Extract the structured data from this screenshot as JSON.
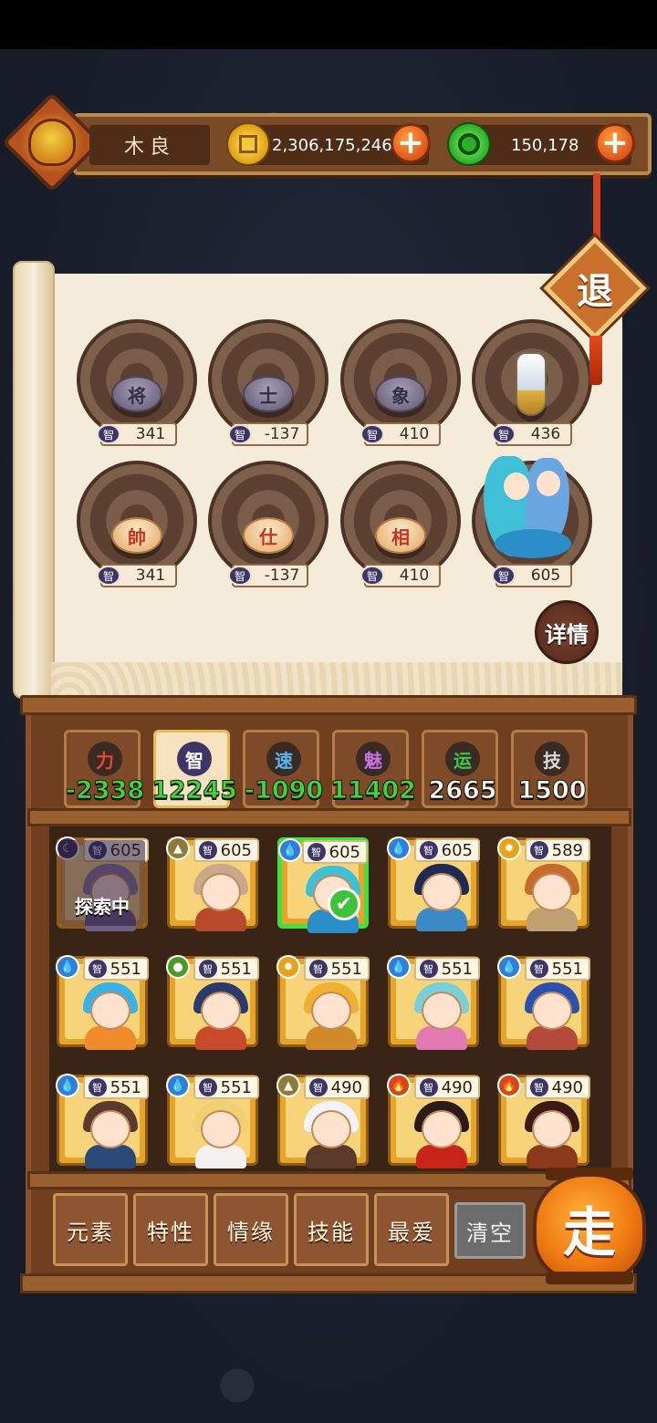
{
  "player": {
    "name": "木良"
  },
  "currencies": {
    "gold": {
      "value": "2,306,175,246",
      "icon": "gold-coin-icon",
      "color": "#e3a515"
    },
    "jade": {
      "value": "150,178",
      "icon": "green-coin-icon",
      "color": "#2fb42a"
    }
  },
  "buttons": {
    "exit": "退",
    "detail": "详情",
    "go": "走",
    "plus": "+"
  },
  "board": {
    "slots": [
      {
        "piece": "将",
        "style": "dark",
        "stat_icon": "智",
        "value": "341"
      },
      {
        "piece": "士",
        "style": "dark",
        "stat_icon": "智",
        "value": "-137"
      },
      {
        "piece": "象",
        "style": "dark",
        "stat_icon": "智",
        "value": "410"
      },
      {
        "piece": "",
        "style": "pawn",
        "stat_icon": "智",
        "value": "436"
      },
      {
        "piece": "帥",
        "style": "light",
        "stat_icon": "智",
        "value": "341"
      },
      {
        "piece": "仕",
        "style": "light",
        "stat_icon": "智",
        "value": "-137"
      },
      {
        "piece": "相",
        "style": "light",
        "stat_icon": "智",
        "value": "410"
      },
      {
        "piece": "",
        "style": "mermaid",
        "stat_icon": "智",
        "value": "605"
      }
    ]
  },
  "attributes": [
    {
      "label": "力",
      "value": "-2338",
      "color": "#3cd83a",
      "glyph_bg": "#3a2a24",
      "glyph_color": "#e8452a",
      "active": false
    },
    {
      "label": "智",
      "value": "12245",
      "color": "#3cd83a",
      "glyph_bg": "#3d3566",
      "glyph_color": "#ffffff",
      "active": true
    },
    {
      "label": "速",
      "value": "-1090",
      "color": "#3cd83a",
      "glyph_bg": "#3a2a24",
      "glyph_color": "#59b4f0",
      "active": false
    },
    {
      "label": "魅",
      "value": "11402",
      "color": "#3cd83a",
      "glyph_bg": "#3a2a24",
      "glyph_color": "#c872e6",
      "active": false
    },
    {
      "label": "运",
      "value": "2665",
      "color": "#ffffff",
      "glyph_bg": "#3a2a24",
      "glyph_color": "#3cc94a",
      "active": false
    },
    {
      "label": "技",
      "value": "1500",
      "color": "#ffffff",
      "glyph_bg": "#3a2a24",
      "glyph_color": "#d8d8d8",
      "active": false
    }
  ],
  "heroes": [
    {
      "element": "moon-icon",
      "elem_glyph": "☾",
      "elem_color": "#3a2a50",
      "stat": "智",
      "power": "605",
      "status": "探索中",
      "selected": false,
      "hair": "#8a7aa0",
      "body": "#6d5f84"
    },
    {
      "element": "earth-icon",
      "elem_glyph": "▲",
      "elem_color": "#8f7a3a",
      "stat": "智",
      "power": "605",
      "status": "",
      "selected": false,
      "hair": "#c9a88c",
      "body": "#b8492a"
    },
    {
      "element": "water-icon",
      "elem_glyph": "💧",
      "elem_color": "#2e7fd6",
      "stat": "智",
      "power": "605",
      "status": "",
      "selected": true,
      "hair": "#3fc0d6",
      "body": "#2c8ec8"
    },
    {
      "element": "water-icon",
      "elem_glyph": "💧",
      "elem_color": "#2e7fd6",
      "stat": "智",
      "power": "605",
      "status": "",
      "selected": false,
      "hair": "#1d2a52",
      "body": "#3b8ac6"
    },
    {
      "element": "light-icon",
      "elem_glyph": "✹",
      "elem_color": "#e8a21a",
      "stat": "智",
      "power": "589",
      "status": "",
      "selected": false,
      "hair": "#c76b2c",
      "body": "#c0a070"
    },
    {
      "element": "water-icon",
      "elem_glyph": "💧",
      "elem_color": "#2e7fd6",
      "stat": "智",
      "power": "551",
      "status": "",
      "selected": false,
      "hair": "#3bb2e6",
      "body": "#f08a2a"
    },
    {
      "element": "wood-icon",
      "elem_glyph": "●",
      "elem_color": "#4a9a2a",
      "stat": "智",
      "power": "551",
      "status": "",
      "selected": false,
      "hair": "#2a3a6a",
      "body": "#c84a2a"
    },
    {
      "element": "light-icon",
      "elem_glyph": "✹",
      "elem_color": "#e8a21a",
      "stat": "智",
      "power": "551",
      "status": "",
      "selected": false,
      "hair": "#f0b030",
      "body": "#d08a2a"
    },
    {
      "element": "water-icon",
      "elem_glyph": "💧",
      "elem_color": "#2e7fd6",
      "stat": "智",
      "power": "551",
      "status": "",
      "selected": false,
      "hair": "#7ad0d8",
      "body": "#e07ab0"
    },
    {
      "element": "water-icon",
      "elem_glyph": "💧",
      "elem_color": "#2e7fd6",
      "stat": "智",
      "power": "551",
      "status": "",
      "selected": false,
      "hair": "#2a50b0",
      "body": "#b44a3a"
    },
    {
      "element": "water-icon",
      "elem_glyph": "💧",
      "elem_color": "#2e7fd6",
      "stat": "智",
      "power": "551",
      "status": "",
      "selected": false,
      "hair": "#5a3a2a",
      "body": "#2a4a7a"
    },
    {
      "element": "water-icon",
      "elem_glyph": "💧",
      "elem_color": "#2e7fd6",
      "stat": "智",
      "power": "551",
      "status": "",
      "selected": false,
      "hair": "#f0d070",
      "body": "#f4f0f0"
    },
    {
      "element": "earth-icon",
      "elem_glyph": "▲",
      "elem_color": "#8f7a3a",
      "stat": "智",
      "power": "490",
      "status": "",
      "selected": false,
      "hair": "#f0f4f8",
      "body": "#5a3a2a"
    },
    {
      "element": "fire-icon",
      "elem_glyph": "🔥",
      "elem_color": "#d4471a",
      "stat": "智",
      "power": "490",
      "status": "",
      "selected": false,
      "hair": "#2a1a1a",
      "body": "#c8241a"
    },
    {
      "element": "fire-icon",
      "elem_glyph": "🔥",
      "elem_color": "#d4471a",
      "stat": "智",
      "power": "490",
      "status": "",
      "selected": false,
      "hair": "#3a1a14",
      "body": "#8a3a1a"
    }
  ],
  "filters": [
    "元素",
    "特性",
    "情缘",
    "技能",
    "最爱"
  ],
  "clear_label": "清空"
}
